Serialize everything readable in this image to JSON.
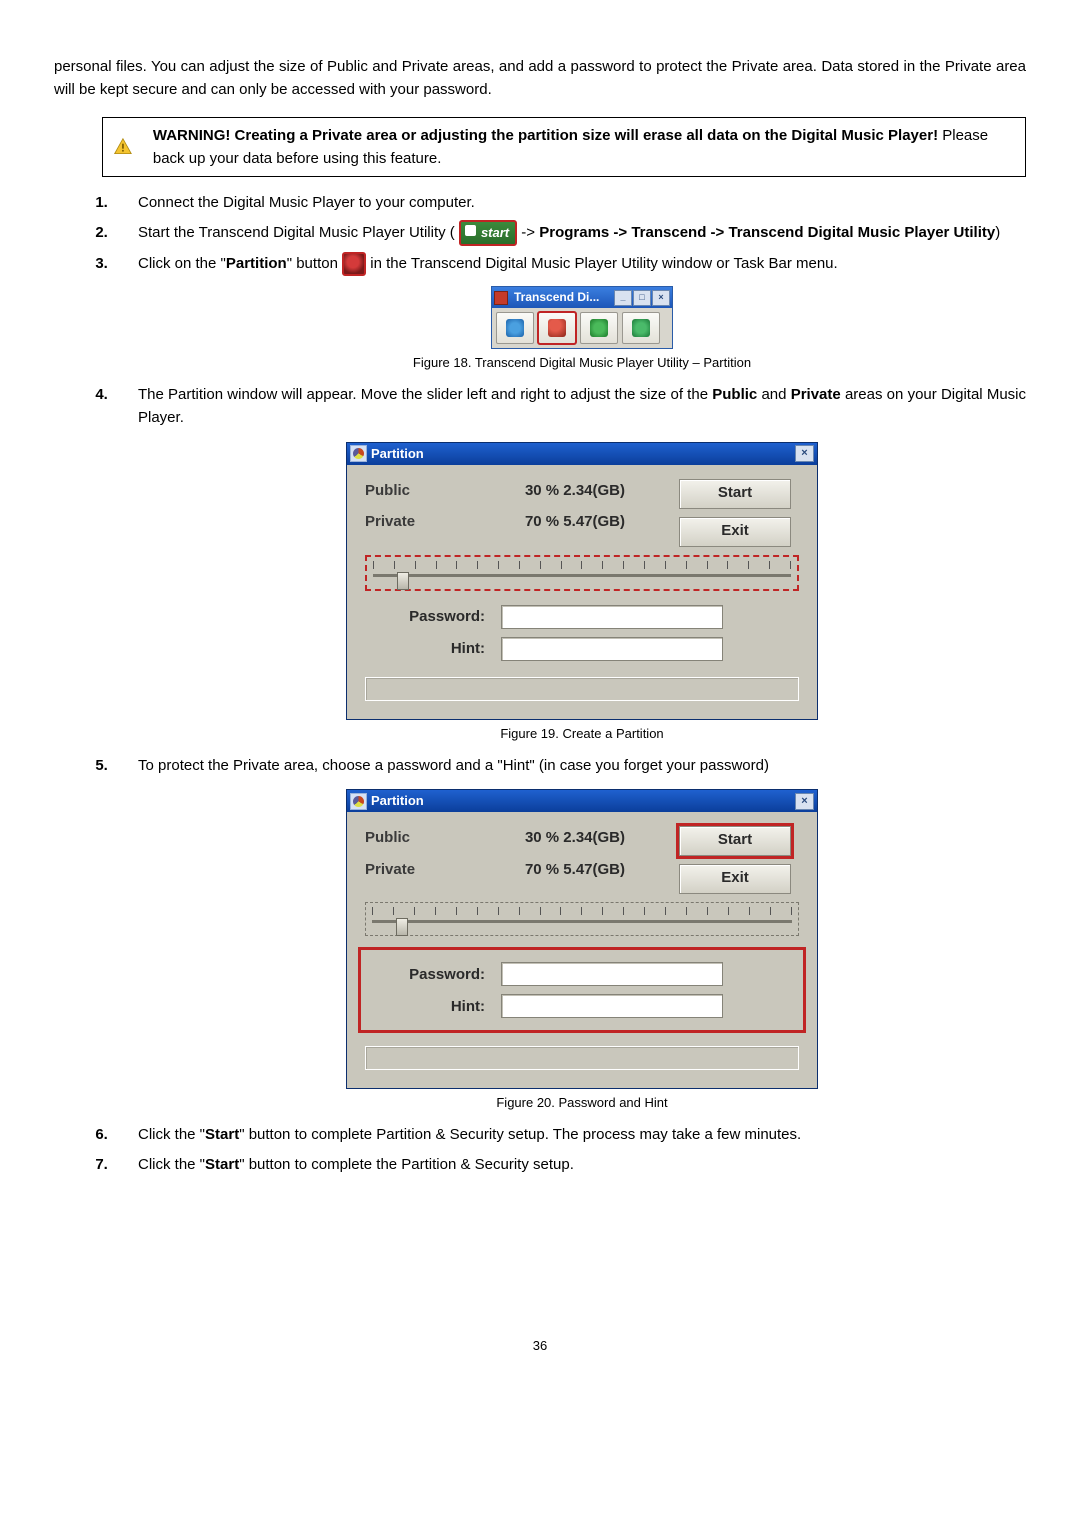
{
  "intro": "personal files. You can adjust the size of Public and Private areas, and add a password to protect the Private area. Data stored in the Private area will be kept secure and can only be accessed with your password.",
  "warning": {
    "bold": "WARNING! Creating a Private area or adjusting the partition size will erase all data on the Digital Music Player! ",
    "rest": "Please back up your data before using this feature."
  },
  "steps": {
    "s1": "Connect the Digital Music Player to your computer.",
    "s2a": "Start the Transcend Digital Music Player Utility ( ",
    "s2_start": "start",
    "s2b": " -> ",
    "s2_bold": "Programs -> Transcend -> Transcend Digital Music Player Utility",
    "s2c": ")",
    "s3a": "Click on the \"",
    "s3_bold": "Partition",
    "s3b": "\" button ",
    "s3c": " in the Transcend Digital Music Player Utility window or Task Bar menu.",
    "s4a": "The Partition window will appear. Move the slider left and right to adjust the size of the ",
    "s4_b1": "Public",
    "s4b": " and ",
    "s4_b2": "Private",
    "s4c": " areas on your Digital Music Player.",
    "s5": "To protect the Private area, choose a password and a \"Hint\" (in case you forget your password)",
    "s6a": "Click the \"",
    "s6_bold": "Start",
    "s6b": "\" button to complete Partition & Security setup. The process may take a few minutes.",
    "s7a": "Click the \"",
    "s7_bold": "Start",
    "s7b": "\" button to complete the Partition & Security setup."
  },
  "fig18": {
    "title": "Transcend Di...",
    "caption": "Figure 18. Transcend Digital Music Player Utility – Partition"
  },
  "partition": {
    "title": "Partition",
    "public_label": "Public",
    "private_label": "Private",
    "public_val": "30  % 2.34(GB)",
    "private_val": "70  % 5.47(GB)",
    "start": "Start",
    "exit": "Exit",
    "password": "Password:",
    "hint": "Hint:"
  },
  "fig19_caption": "Figure 19. Create a Partition",
  "fig20_caption": "Figure 20. Password and Hint",
  "page": "36"
}
